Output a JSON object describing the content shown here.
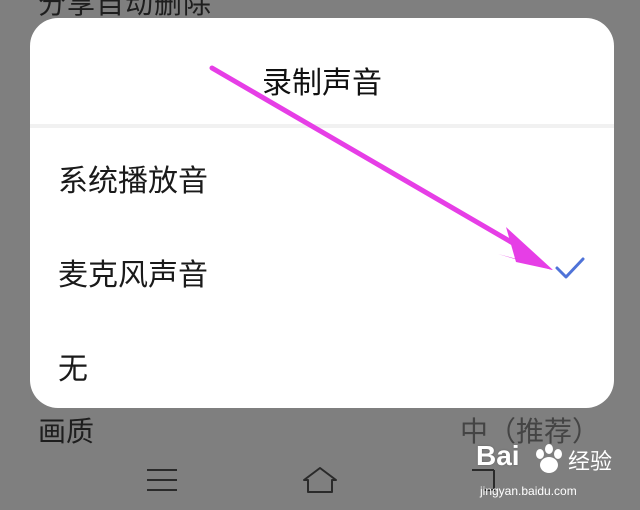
{
  "background": {
    "top_row_label": "分享自动删除",
    "quality_label": "画质",
    "quality_value": "中（推荐）"
  },
  "dialog": {
    "title": "录制声音",
    "options": [
      {
        "label": "系统播放音",
        "selected": false
      },
      {
        "label": "麦克风声音",
        "selected": true
      },
      {
        "label": "无",
        "selected": false
      }
    ]
  },
  "navbar": {
    "icons": [
      "menu-icon",
      "home-icon",
      "back-icon"
    ]
  },
  "watermark": {
    "brand": "Bai",
    "cn": "经验",
    "url": "jingyan.baidu.com"
  },
  "colors": {
    "check": "#4f73d8",
    "arrow": "#e63ee6",
    "overlay": "#7f7f7f"
  }
}
